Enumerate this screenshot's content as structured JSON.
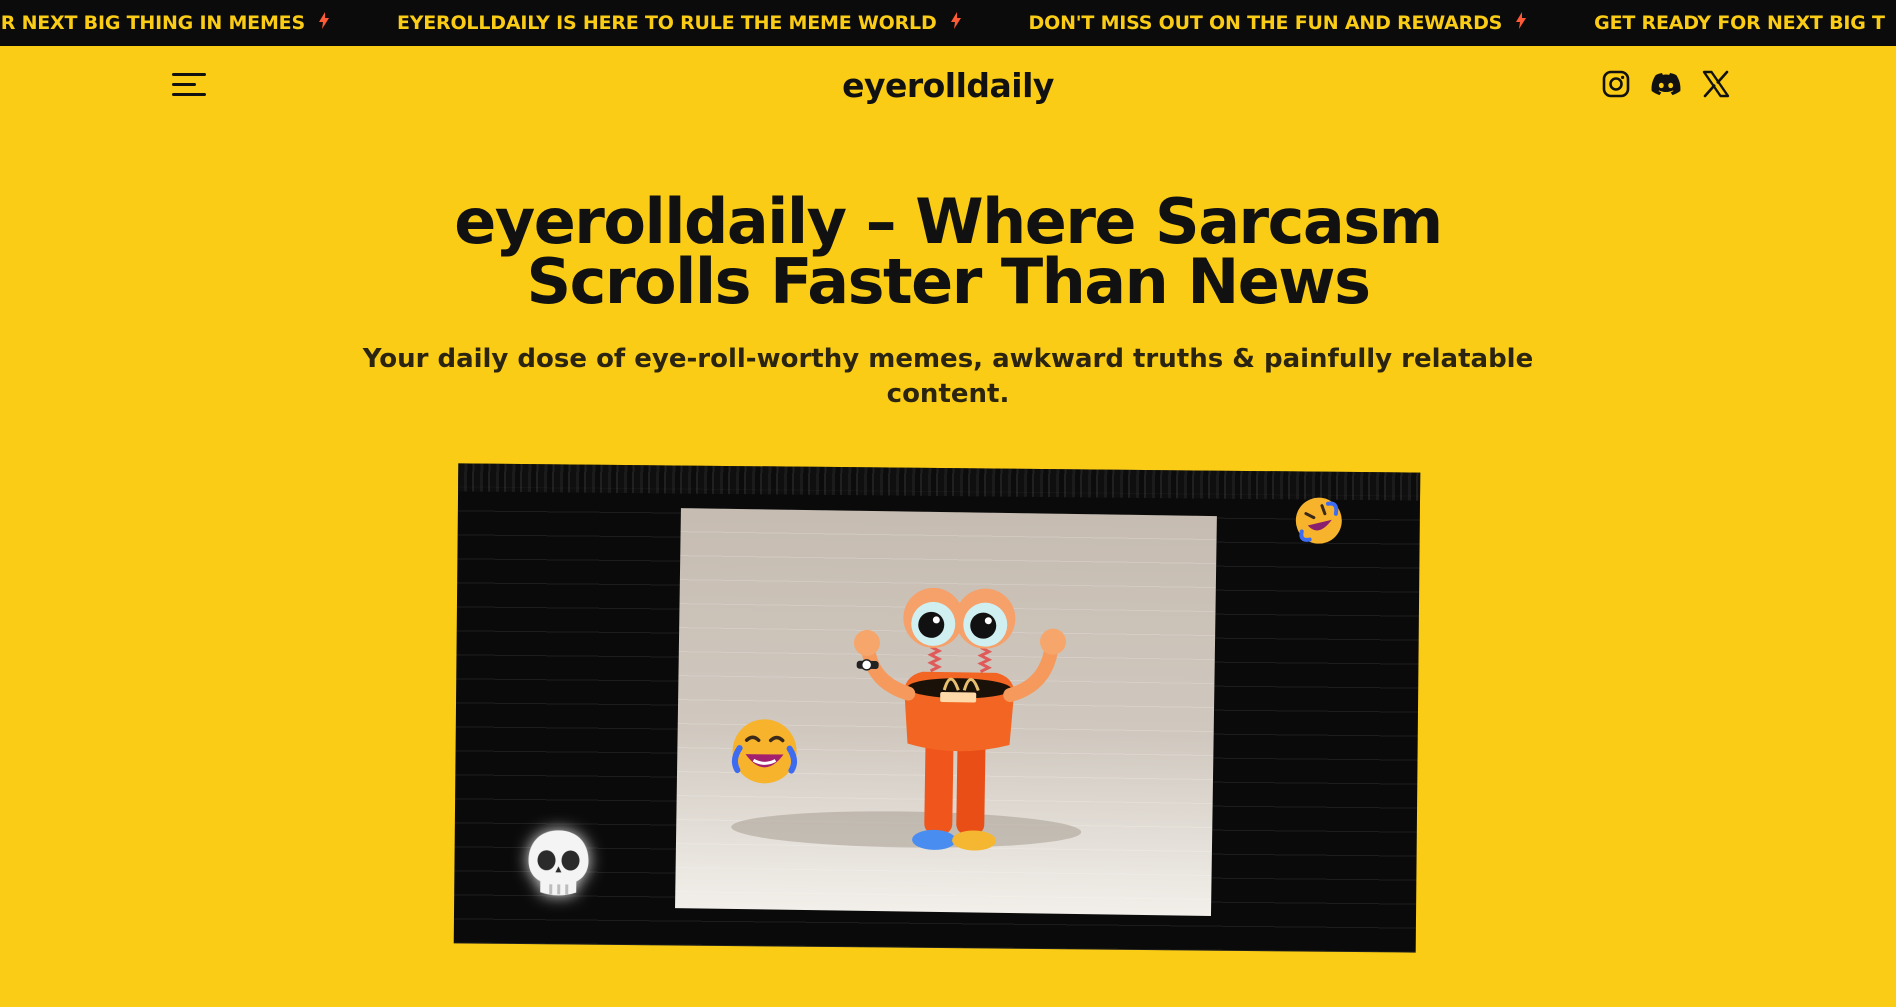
{
  "ticker": {
    "items": [
      "FOR NEXT BIG THING IN MEMES",
      "EYEROLLDAILY IS HERE TO RULE THE MEME WORLD",
      "DON'T MISS OUT ON THE FUN AND REWARDS",
      "GET READY FOR NEXT BIG T"
    ],
    "bolt_icon": "lightning-bolt-icon",
    "colors": {
      "background": "#0b0b0b",
      "text": "#facc15",
      "bolt": "#ff5a36"
    }
  },
  "header": {
    "logo": "eyerolldaily",
    "menu_icon": "hamburger-menu-icon",
    "socials": [
      {
        "name": "instagram-icon"
      },
      {
        "name": "discord-icon"
      },
      {
        "name": "x-twitter-icon"
      }
    ]
  },
  "hero": {
    "title_brand": "eyerolldaily",
    "title_rest_line1": " – Where Sarcasm",
    "title_line2": "Scrolls Faster Than News",
    "subtitle": "Your daily dose of eye-roll-worthy memes, awkward truths & painfully relatable content."
  },
  "media": {
    "character": "eyeball-character-illustration",
    "emojis": [
      "rolling-on-floor-laughing-emoji",
      "face-with-tears-of-joy-emoji",
      "skull-emoji"
    ]
  },
  "colors": {
    "page_background": "#facc15",
    "text": "#111111",
    "accent_shadow": "#19b7c8"
  }
}
